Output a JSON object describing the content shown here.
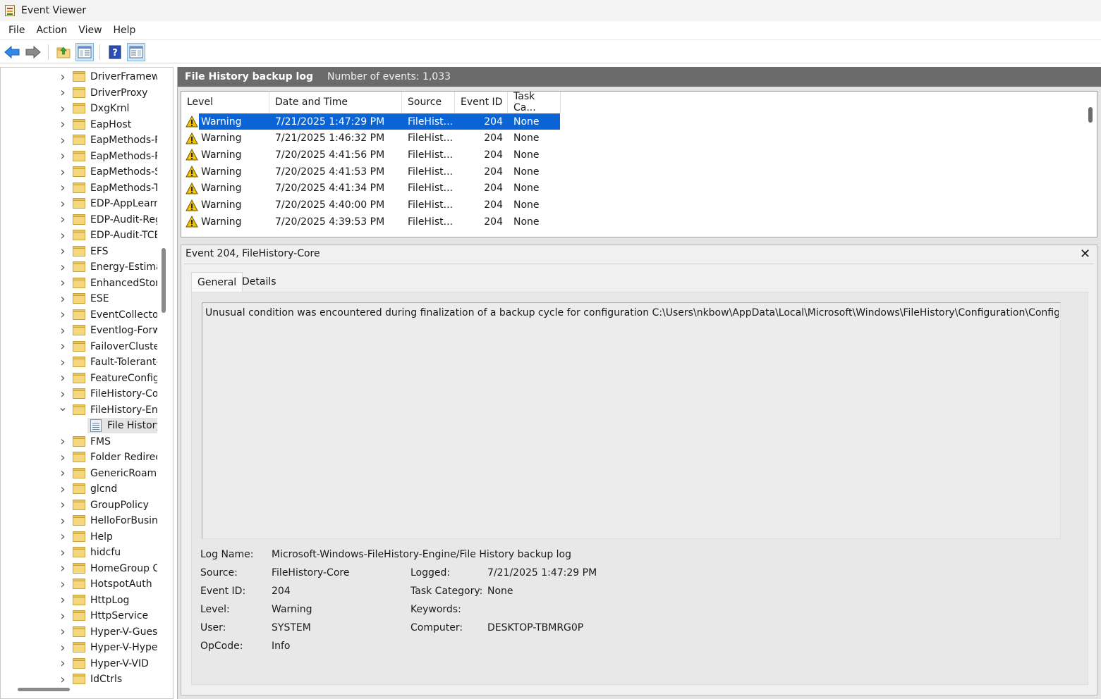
{
  "window": {
    "title": "Event Viewer"
  },
  "menu": [
    "File",
    "Action",
    "View",
    "Help"
  ],
  "toolbar": {
    "icons": [
      "back-arrow-icon",
      "forward-arrow-icon",
      "up-folder-icon",
      "show-hide-tree-icon",
      "help-icon",
      "show-hide-action-pane-icon"
    ]
  },
  "tree": {
    "items": [
      "DriverFramewo",
      "DriverProxy",
      "DxgKrnl",
      "EapHost",
      "EapMethods-R",
      "EapMethods-R",
      "EapMethods-S",
      "EapMethods-T",
      "EDP-AppLearni",
      "EDP-Audit-Reg",
      "EDP-Audit-TCB",
      "EFS",
      "Energy-Estima",
      "EnhancedStora",
      "ESE",
      "EventCollector",
      "Eventlog-Forw",
      "FailoverCluster",
      "Fault-Tolerant-",
      "FeatureConfigu",
      "FileHistory-Cor",
      "FileHistory-Eng",
      "File History",
      "FMS",
      "Folder Redirect",
      "GenericRoamin",
      "glcnd",
      "GroupPolicy",
      "HelloForBusine",
      "Help",
      "hidcfu",
      "HomeGroup Co",
      "HotspotAuth",
      "HttpLog",
      "HttpService",
      "Hyper-V-Guest",
      "Hyper-V-Hype",
      "Hyper-V-VID",
      "IdCtrls"
    ]
  },
  "log": {
    "title": "File History backup log",
    "count_text": "Number of events: 1,033"
  },
  "events": {
    "columns": [
      "Level",
      "Date and Time",
      "Source",
      "Event ID",
      "Task Ca..."
    ],
    "rows": [
      [
        "Warning",
        "7/21/2025 1:47:29 PM",
        "FileHist...",
        "204",
        "None"
      ],
      [
        "Warning",
        "7/21/2025 1:46:32 PM",
        "FileHist...",
        "204",
        "None"
      ],
      [
        "Warning",
        "7/20/2025 4:41:56 PM",
        "FileHist...",
        "204",
        "None"
      ],
      [
        "Warning",
        "7/20/2025 4:41:53 PM",
        "FileHist...",
        "204",
        "None"
      ],
      [
        "Warning",
        "7/20/2025 4:41:34 PM",
        "FileHist...",
        "204",
        "None"
      ],
      [
        "Warning",
        "7/20/2025 4:40:00 PM",
        "FileHist...",
        "204",
        "None"
      ],
      [
        "Warning",
        "7/20/2025 4:39:53 PM",
        "FileHist...",
        "204",
        "None"
      ]
    ]
  },
  "detail": {
    "title": "Event 204, FileHistory-Core",
    "tabs": [
      "General",
      "Details"
    ],
    "description": "Unusual condition was encountered during finalization of a backup cycle for configuration C:\\Users\\nkbow\\AppData\\Local\\Microsoft\\Windows\\FileHistory\\Configuration\\Config",
    "props": {
      "log_name_label": "Log Name:",
      "log_name": "Microsoft-Windows-FileHistory-Engine/File History backup log",
      "source_label": "Source:",
      "source": "FileHistory-Core",
      "logged_label": "Logged:",
      "logged": "7/21/2025 1:47:29 PM",
      "event_id_label": "Event ID:",
      "event_id": "204",
      "task_category_label": "Task Category:",
      "task_category": "None",
      "level_label": "Level:",
      "level": "Warning",
      "keywords_label": "Keywords:",
      "keywords": "",
      "user_label": "User:",
      "user": "SYSTEM",
      "computer_label": "Computer:",
      "computer": "DESKTOP-TBMRG0P",
      "opcode_label": "OpCode:",
      "opcode": "Info"
    }
  },
  "colors": {
    "selection": "#0a64d6",
    "header_bar": "#6b6b6b",
    "warning": "#f2c200"
  }
}
